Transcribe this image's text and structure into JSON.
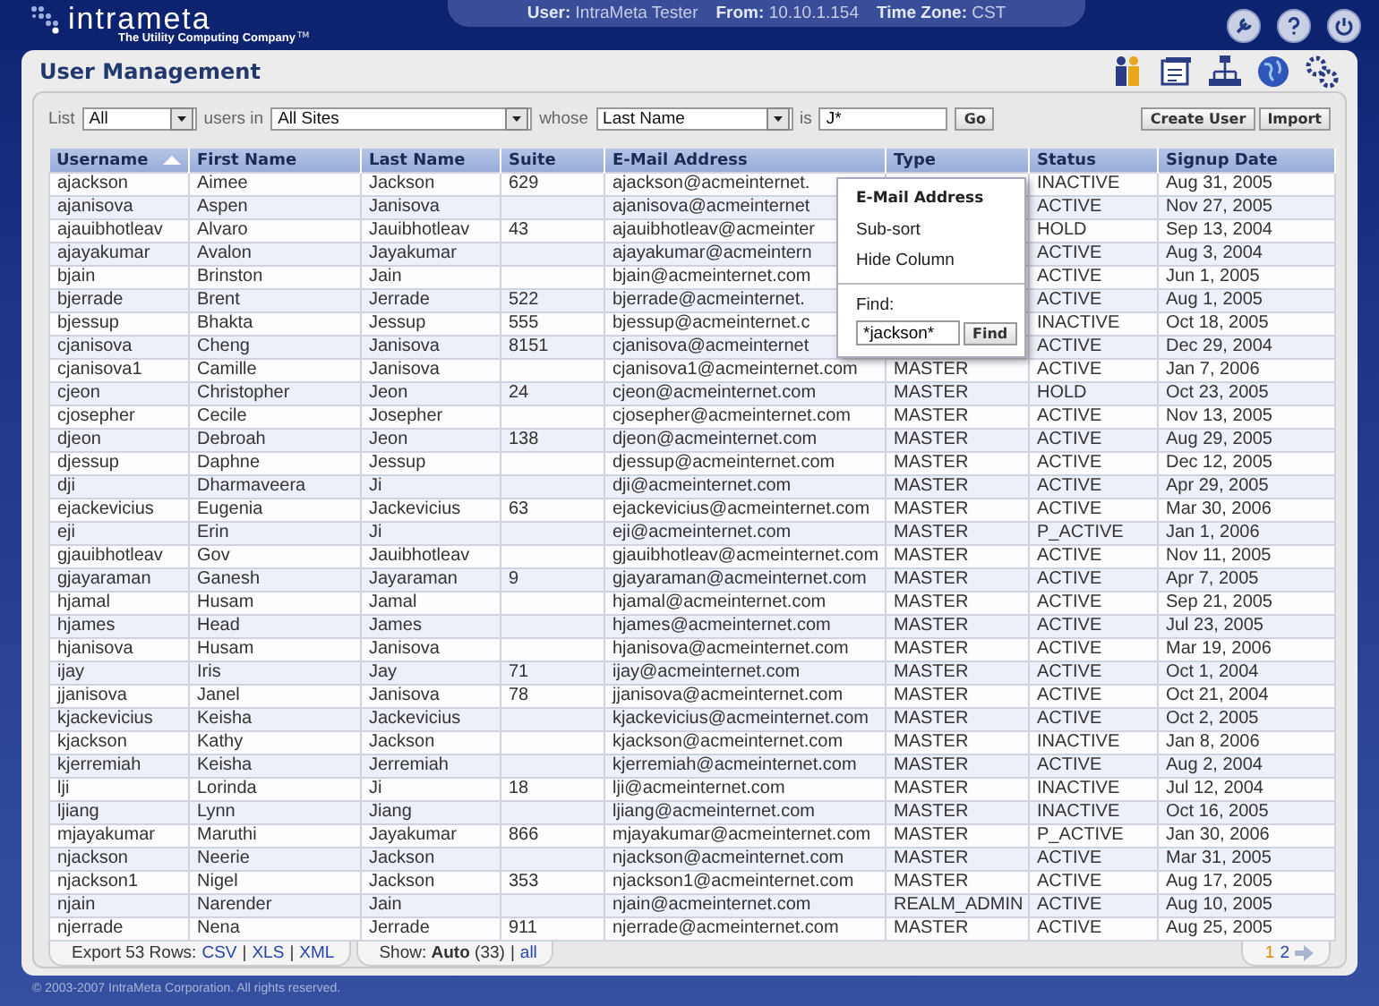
{
  "header": {
    "logo_text": "intrameta",
    "tagline": "The Utility Computing Company",
    "trademark": "TM",
    "session": [
      {
        "label": "User:",
        "value": "IntraMeta Tester"
      },
      {
        "label": "From:",
        "value": "10.10.1.154"
      },
      {
        "label": "Time Zone:",
        "value": "CST"
      }
    ]
  },
  "page_title": "User Management",
  "filter": {
    "list_label": "List",
    "list_value": "All",
    "users_in_label": "users in",
    "site_value": "All Sites",
    "whose_label": "whose",
    "field_value": "Last Name",
    "is_label": "is",
    "query_value": "J*",
    "go_button": "Go"
  },
  "actions": [
    "Create User",
    "Import"
  ],
  "table": {
    "columns": [
      {
        "label": "Username",
        "sorted": true
      },
      {
        "label": "First Name",
        "sorted": false
      },
      {
        "label": "Last Name",
        "sorted": false
      },
      {
        "label": "Suite",
        "sorted": false
      },
      {
        "label": "E-Mail Address",
        "sorted": false
      },
      {
        "label": "Type",
        "sorted": false
      },
      {
        "label": "Status",
        "sorted": false
      },
      {
        "label": "Signup Date",
        "sorted": false
      }
    ],
    "rows": [
      [
        "ajackson",
        "Aimee",
        "Jackson",
        "629",
        "ajackson@acmeinternet.",
        null,
        "INACTIVE",
        "Aug 31, 2005"
      ],
      [
        "ajanisova",
        "Aspen",
        "Janisova",
        null,
        "ajanisova@acmeinternet",
        null,
        "ACTIVE",
        "Nov 27, 2005"
      ],
      [
        "ajauibhotleav",
        "Alvaro",
        "Jauibhotleav",
        "43",
        "ajauibhotleav@acmeinter",
        null,
        "HOLD",
        "Sep 13, 2004"
      ],
      [
        "ajayakumar",
        "Avalon",
        "Jayakumar",
        null,
        "ajayakumar@acmeintern",
        null,
        "ACTIVE",
        "Aug 3, 2004"
      ],
      [
        "bjain",
        "Brinston",
        "Jain",
        null,
        "bjain@acmeinternet.com",
        null,
        "ACTIVE",
        "Jun 1, 2005"
      ],
      [
        "bjerrade",
        "Brent",
        "Jerrade",
        "522",
        "bjerrade@acmeinternet.",
        null,
        "ACTIVE",
        "Aug 1, 2005"
      ],
      [
        "bjessup",
        "Bhakta",
        "Jessup",
        "555",
        "bjessup@acmeinternet.c",
        null,
        "INACTIVE",
        "Oct 18, 2005"
      ],
      [
        "cjanisova",
        "Cheng",
        "Janisova",
        "8151",
        "cjanisova@acmeinternet",
        null,
        "ACTIVE",
        "Dec 29, 2004"
      ],
      [
        "cjanisova1",
        "Camille",
        "Janisova",
        null,
        "cjanisova1@acmeinternet.com",
        "MASTER",
        "ACTIVE",
        "Jan 7, 2006"
      ],
      [
        "cjeon",
        "Christopher",
        "Jeon",
        "24",
        "cjeon@acmeinternet.com",
        "MASTER",
        "HOLD",
        "Oct 23, 2005"
      ],
      [
        "cjosepher",
        "Cecile",
        "Josepher",
        null,
        "cjosepher@acmeinternet.com",
        "MASTER",
        "ACTIVE",
        "Nov 13, 2005"
      ],
      [
        "djeon",
        "Debroah",
        "Jeon",
        "138",
        "djeon@acmeinternet.com",
        "MASTER",
        "ACTIVE",
        "Aug 29, 2005"
      ],
      [
        "djessup",
        "Daphne",
        "Jessup",
        null,
        "djessup@acmeinternet.com",
        "MASTER",
        "ACTIVE",
        "Dec 12, 2005"
      ],
      [
        "dji",
        "Dharmaveera",
        "Ji",
        null,
        "dji@acmeinternet.com",
        "MASTER",
        "ACTIVE",
        "Apr 29, 2005"
      ],
      [
        "ejackevicius",
        "Eugenia",
        "Jackevicius",
        "63",
        "ejackevicius@acmeinternet.com",
        "MASTER",
        "ACTIVE",
        "Mar 30, 2006"
      ],
      [
        "eji",
        "Erin",
        "Ji",
        null,
        "eji@acmeinternet.com",
        "MASTER",
        "P_ACTIVE",
        "Jan 1, 2006"
      ],
      [
        "gjauibhotleav",
        "Gov",
        "Jauibhotleav",
        null,
        "gjauibhotleav@acmeinternet.com",
        "MASTER",
        "ACTIVE",
        "Nov 11, 2005"
      ],
      [
        "gjayaraman",
        "Ganesh",
        "Jayaraman",
        "9",
        "gjayaraman@acmeinternet.com",
        "MASTER",
        "ACTIVE",
        "Apr 7, 2005"
      ],
      [
        "hjamal",
        "Husam",
        "Jamal",
        null,
        "hjamal@acmeinternet.com",
        "MASTER",
        "ACTIVE",
        "Sep 21, 2005"
      ],
      [
        "hjames",
        "Head",
        "James",
        null,
        "hjames@acmeinternet.com",
        "MASTER",
        "ACTIVE",
        "Jul 23, 2005"
      ],
      [
        "hjanisova",
        "Husam",
        "Janisova",
        null,
        "hjanisova@acmeinternet.com",
        "MASTER",
        "ACTIVE",
        "Mar 19, 2006"
      ],
      [
        "ijay",
        "Iris",
        "Jay",
        "71",
        "ijay@acmeinternet.com",
        "MASTER",
        "ACTIVE",
        "Oct 1, 2004"
      ],
      [
        "jjanisova",
        "Janel",
        "Janisova",
        "78",
        "jjanisova@acmeinternet.com",
        "MASTER",
        "ACTIVE",
        "Oct 21, 2004"
      ],
      [
        "kjackevicius",
        "Keisha",
        "Jackevicius",
        null,
        "kjackevicius@acmeinternet.com",
        "MASTER",
        "ACTIVE",
        "Oct 2, 2005"
      ],
      [
        "kjackson",
        "Kathy",
        "Jackson",
        null,
        "kjackson@acmeinternet.com",
        "MASTER",
        "INACTIVE",
        "Jan 8, 2006"
      ],
      [
        "kjerremiah",
        "Keisha",
        "Jerremiah",
        null,
        "kjerremiah@acmeinternet.com",
        "MASTER",
        "ACTIVE",
        "Aug 2, 2004"
      ],
      [
        "lji",
        "Lorinda",
        "Ji",
        "18",
        "lji@acmeinternet.com",
        "MASTER",
        "INACTIVE",
        "Jul 12, 2004"
      ],
      [
        "ljiang",
        "Lynn",
        "Jiang",
        null,
        "ljiang@acmeinternet.com",
        "MASTER",
        "INACTIVE",
        "Oct 16, 2005"
      ],
      [
        "mjayakumar",
        "Maruthi",
        "Jayakumar",
        "866",
        "mjayakumar@acmeinternet.com",
        "MASTER",
        "P_ACTIVE",
        "Jan 30, 2006"
      ],
      [
        "njackson",
        "Neerie",
        "Jackson",
        null,
        "njackson@acmeinternet.com",
        "MASTER",
        "ACTIVE",
        "Mar 31, 2005"
      ],
      [
        "njackson1",
        "Nigel",
        "Jackson",
        "353",
        "njackson1@acmeinternet.com",
        "MASTER",
        "ACTIVE",
        "Aug 17, 2005"
      ],
      [
        "njain",
        "Narender",
        "Jain",
        null,
        "njain@acmeinternet.com",
        "REALM_ADMIN",
        "ACTIVE",
        "Aug 10, 2005"
      ],
      [
        "njerrade",
        "Nena",
        "Jerrade",
        "911",
        "njerrade@acmeinternet.com",
        "MASTER",
        "ACTIVE",
        "Aug 25, 2005"
      ]
    ]
  },
  "column_menu": {
    "title": "E-Mail Address",
    "items": [
      "Sub-sort",
      "Hide Column"
    ],
    "find_label": "Find:",
    "find_value": "*jackson*",
    "find_button": "Find"
  },
  "footer": {
    "export_label": "Export 53 Rows:",
    "formats": [
      "CSV",
      "XLS",
      "XML"
    ],
    "separator": "|",
    "show_text": "Show: **Auto** (33)",
    "show_all": "all",
    "pages": [
      {
        "label": "1",
        "selected": true
      },
      {
        "label": "2",
        "selected": false
      }
    ]
  },
  "copyright": "© 2003-2007 IntraMeta Corporation.  All rights reserved."
}
